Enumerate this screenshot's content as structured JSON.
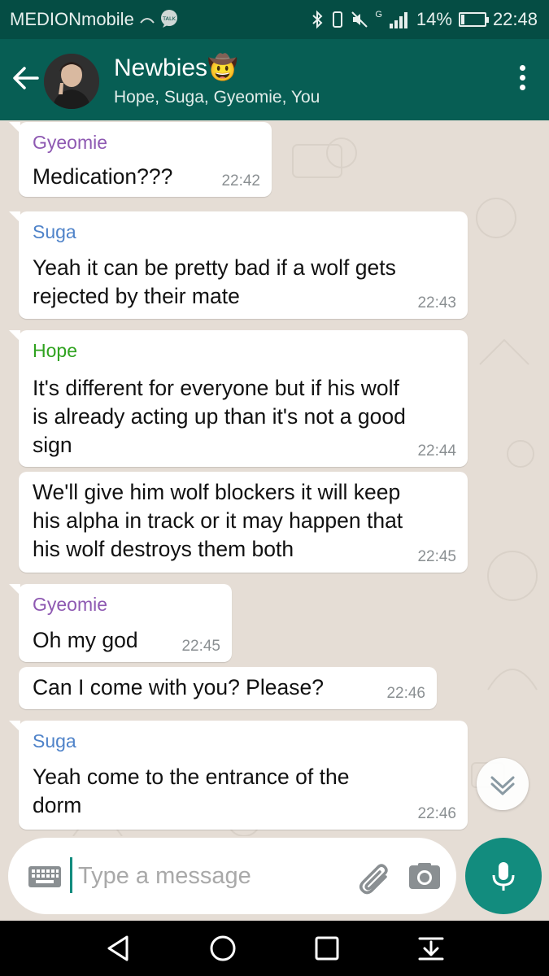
{
  "status_bar": {
    "carrier": "MEDIONmobile",
    "notif_icons": [
      "music-icon",
      "talk-icon"
    ],
    "talk_badge": "TALK",
    "battery_text": "14%",
    "battery_level": 0.14,
    "network": "G",
    "time": "22:48"
  },
  "header": {
    "title": "Newbies🤠",
    "subtitle": "Hope, Suga, Gyeomie, You"
  },
  "colors": {
    "header": "#075e54",
    "status_bar": "#054d44",
    "accent": "#128c7e",
    "chat_bg": "#e5ddd5",
    "sender_gyeomie": "#8e59b2",
    "sender_suga": "#4f83c9",
    "sender_hope": "#2fa21f"
  },
  "messages": [
    {
      "sender": "Gyeomie",
      "lines": [
        "Medication???"
      ],
      "time": "22:42"
    },
    {
      "sender": "Suga",
      "lines": [
        "Yeah it can be pretty bad if a wolf gets",
        "rejected by their mate"
      ],
      "time": "22:43"
    },
    {
      "sender": "Hope",
      "lines": [
        "It's different for everyone but if his wolf",
        "is already acting up than it's not a good",
        "sign"
      ],
      "time": "22:44"
    },
    {
      "sender": "",
      "lines": [
        "We'll give him wolf blockers it will keep",
        "his alpha in track or it may happen that",
        "his wolf destroys them both"
      ],
      "time": "22:45"
    },
    {
      "sender": "Gyeomie",
      "lines": [
        "Oh my god"
      ],
      "time": "22:45"
    },
    {
      "sender": "",
      "lines": [
        "Can I come with you? Please?"
      ],
      "time": "22:46"
    },
    {
      "sender": "Suga",
      "lines": [
        "Yeah come to the entrance of the",
        "dorm"
      ],
      "time": "22:46"
    }
  ],
  "composer": {
    "placeholder": "Type a message",
    "value": ""
  },
  "icons": {
    "back": "arrow-left-icon",
    "menu": "more-vert-icon",
    "scroll": "chevron-double-down-icon",
    "keyboard": "keyboard-icon",
    "attach": "paperclip-icon",
    "camera": "camera-icon",
    "mic": "mic-icon",
    "nav": [
      "back-triangle-icon",
      "home-circle-icon",
      "recents-square-icon",
      "notification-pull-icon"
    ]
  }
}
